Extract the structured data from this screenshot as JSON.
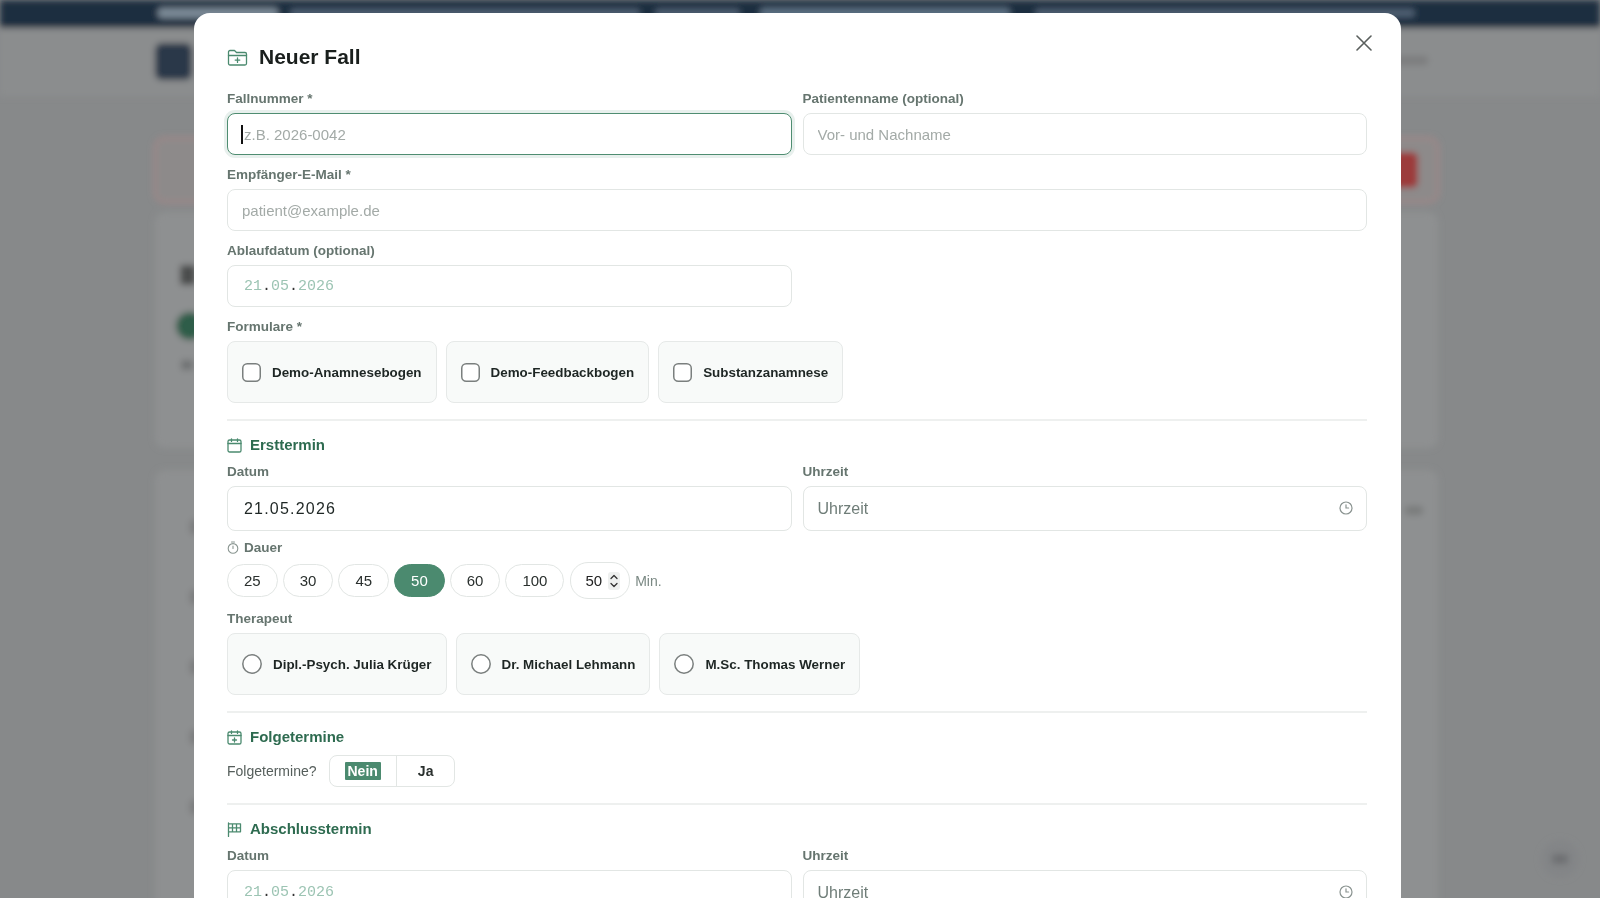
{
  "dialog": {
    "title": "Neuer Fall"
  },
  "case_fields": [
    {
      "label": "Fallnummer *",
      "placeholder": "z.B. 2026-0042",
      "focused": true
    },
    {
      "label": "Patientenname (optional)",
      "placeholder": "Vor- und Nachname",
      "focused": false
    }
  ],
  "email_field": {
    "label": "Empfänger-E-Mail *",
    "placeholder": "patient@example.de"
  },
  "expiry_field": {
    "label": "Ablaufdatum (optional)",
    "placeholder": "21.05.2026"
  },
  "forms": {
    "label": "Formulare *",
    "items": [
      {
        "label": "Demo-Anamnesebogen",
        "checked": false
      },
      {
        "label": "Demo-Feedbackbogen",
        "checked": false
      },
      {
        "label": "Substanzanamnese",
        "checked": false
      }
    ]
  },
  "first_appointment": {
    "heading": "Ersttermin",
    "date": {
      "label": "Datum",
      "value": "21.05.2026"
    },
    "time": {
      "label": "Uhrzeit",
      "placeholder": "Uhrzeit"
    },
    "duration": {
      "label": "Dauer",
      "options": [
        {
          "label": "25",
          "selected": false
        },
        {
          "label": "30",
          "selected": false
        },
        {
          "label": "45",
          "selected": false
        },
        {
          "label": "50",
          "selected": true
        },
        {
          "label": "60",
          "selected": false
        },
        {
          "label": "100",
          "selected": false
        }
      ],
      "custom_value": "50",
      "unit": "Min."
    },
    "therapist": {
      "label": "Therapeut",
      "options": [
        {
          "label": "Dipl.-Psych. Julia Krüger",
          "selected": false
        },
        {
          "label": "Dr. Michael Lehmann",
          "selected": false
        },
        {
          "label": "M.Sc. Thomas Werner",
          "selected": false
        }
      ]
    }
  },
  "follow_ups": {
    "heading": "Folgetermine",
    "question": "Folgetermine?",
    "options": [
      {
        "label": "Nein",
        "selected": true
      },
      {
        "label": "Ja",
        "selected": false
      }
    ]
  },
  "final_appointment": {
    "heading": "Abschlusstermin",
    "date": {
      "label": "Datum",
      "placeholder": "21.05.2026"
    },
    "time": {
      "label": "Uhrzeit",
      "placeholder": "Uhrzeit"
    }
  }
}
